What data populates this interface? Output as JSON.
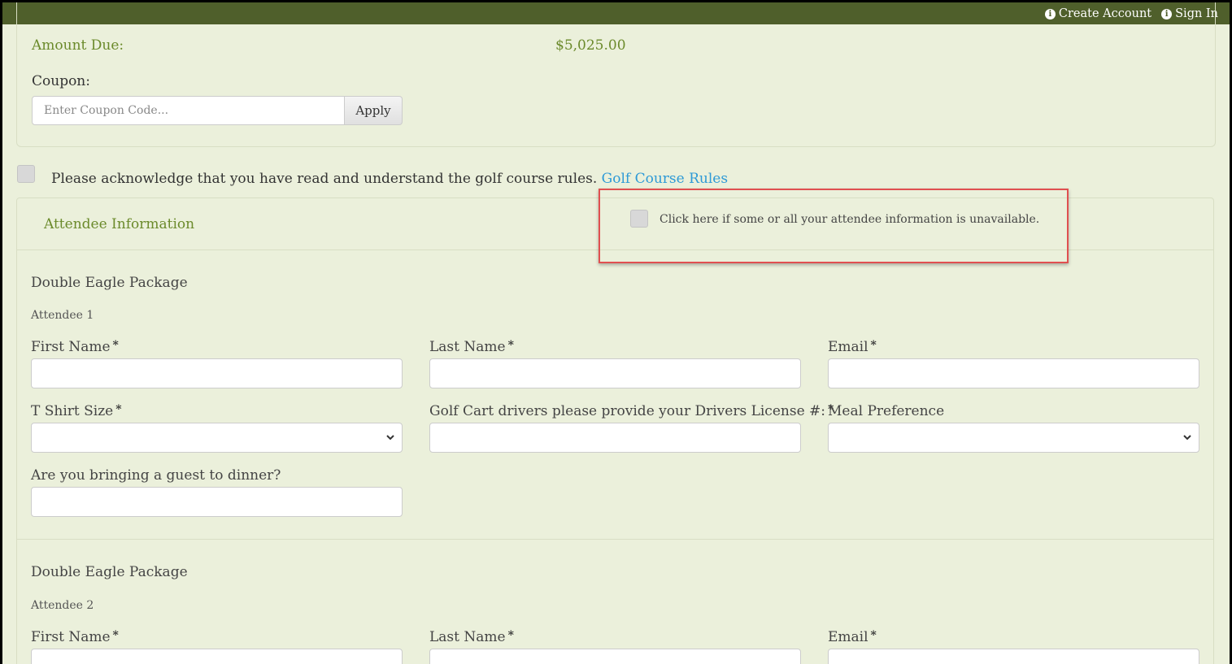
{
  "topbar": {
    "create_account": "Create Account",
    "sign_in": "Sign In",
    "bg_color": "#4f5f2b"
  },
  "payment": {
    "amount_due_label": "Amount Due:",
    "amount_due_value": "$5,025.00",
    "coupon_label": "Coupon:",
    "coupon_placeholder": "Enter Coupon Code...",
    "apply_label": "Apply"
  },
  "acknowledge": {
    "text": "Please acknowledge that you have read and understand the golf course rules.",
    "link_text": "Golf Course Rules",
    "checked": false
  },
  "attendee_section": {
    "title": "Attendee Information",
    "unavailable_text": "Click here if some or all your attendee information is unavailable.",
    "unavailable_checked": false
  },
  "attendees": [
    {
      "package": "Double Eagle Package",
      "attendee_label": "Attendee 1",
      "fields": {
        "first_name": "First Name",
        "last_name": "Last Name",
        "email": "Email",
        "tshirt": "T Shirt Size",
        "license": "Golf Cart drivers please provide your Drivers License #:",
        "meal": "Meal Preference",
        "guest": "Are you bringing a guest to dinner?"
      },
      "required_mark": "*"
    },
    {
      "package": "Double Eagle Package",
      "attendee_label": "Attendee 2",
      "fields": {
        "first_name": "First Name",
        "last_name": "Last Name",
        "email": "Email"
      },
      "required_mark": "*"
    }
  ],
  "colors": {
    "page_bg": "#ebf0db",
    "accent_green": "#6b8a2b",
    "link_blue": "#2e9ad6",
    "highlight_red": "#e05050"
  }
}
